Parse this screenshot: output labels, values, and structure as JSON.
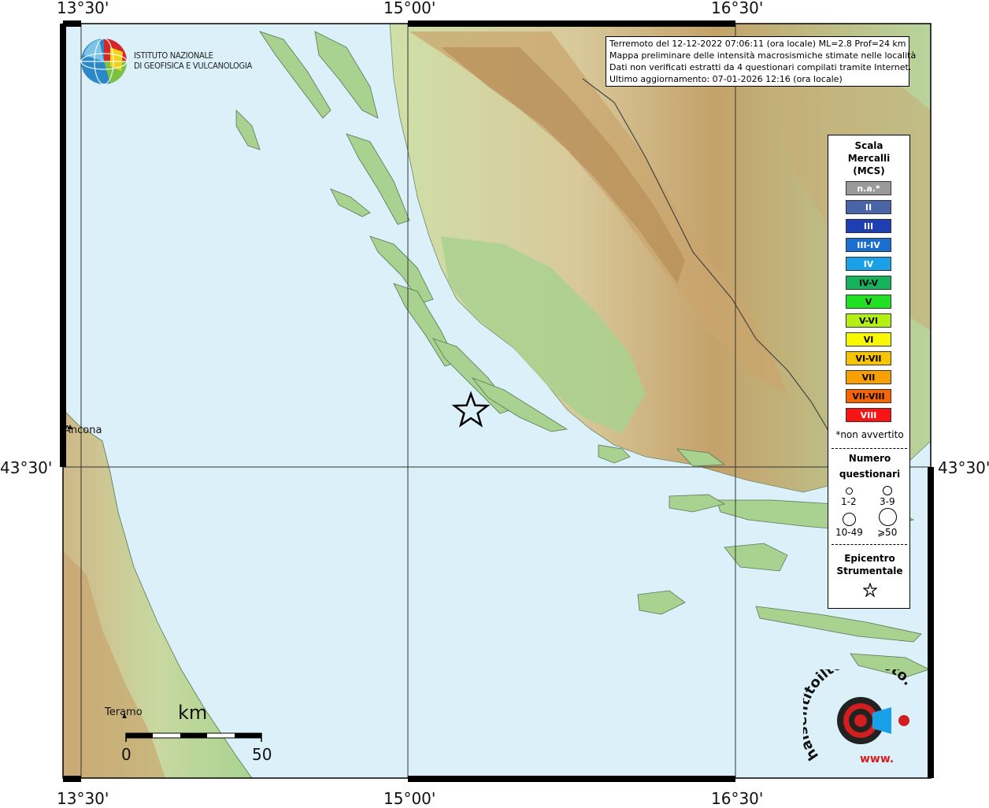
{
  "header_box": {
    "lines": [
      "Terremoto del 12-12-2022 07:06:11 (ora locale) ML=2.8 Prof=24 km",
      "Mappa preliminare delle intensità macrosismiche stimate nelle località",
      "Dati non verificati estratti da 4 questionari compilati tramite Internet.",
      "Ultimo aggiornamento: 07-01-2026 12:16 (ora locale)"
    ]
  },
  "axes": {
    "longitude_ticks": [
      "13°30'",
      "15°00'",
      "16°30'"
    ],
    "latitude_ticks": [
      "43°30'"
    ]
  },
  "logo": {
    "ingv_line1": "ISTITUTO NAZIONALE",
    "ingv_line2": "DI GEOFISICA E VULCANOLOGIA",
    "hsit_text": "haisentitoilterremoto.it",
    "hsit_www": "www."
  },
  "cities": {
    "ancona": "Ancona",
    "teramo": "Teramo"
  },
  "scale_bar": {
    "unit": "km",
    "start": "0",
    "end": "50"
  },
  "legend": {
    "title_1": "Scala",
    "title_2": "Mercalli",
    "title_3": "(MCS)",
    "intensities": [
      {
        "label": "n.a.*",
        "color": "#9a9a9a"
      },
      {
        "label": "II",
        "color": "#4a64a8"
      },
      {
        "label": "III",
        "color": "#1e3fb4"
      },
      {
        "label": "III-IV",
        "color": "#1a6ed0"
      },
      {
        "label": "IV",
        "color": "#1aa0e6"
      },
      {
        "label": "IV-V",
        "color": "#16b45a"
      },
      {
        "label": "V",
        "color": "#22e022"
      },
      {
        "label": "V-VI",
        "color": "#b4f014"
      },
      {
        "label": "VI",
        "color": "#f8f800"
      },
      {
        "label": "VI-VII",
        "color": "#f8c400"
      },
      {
        "label": "VII",
        "color": "#f8a000"
      },
      {
        "label": "VII-VIII",
        "color": "#f86400"
      },
      {
        "label": "VIII",
        "color": "#f81414"
      }
    ],
    "not_felt_note": "*non avvertito",
    "questionnaire_title_1": "Numero",
    "questionnaire_title_2": "questionari",
    "questionnaire_sizes": [
      "1-2",
      "3-9",
      "10-49",
      "⩾50"
    ],
    "epicenter_title_1": "Epicentro",
    "epicenter_title_2": "Strumentale"
  },
  "colors": {
    "sea": "#dcf0fa",
    "land": "#a8d08c",
    "highland": "#c9a96e",
    "frame": "#000000"
  }
}
